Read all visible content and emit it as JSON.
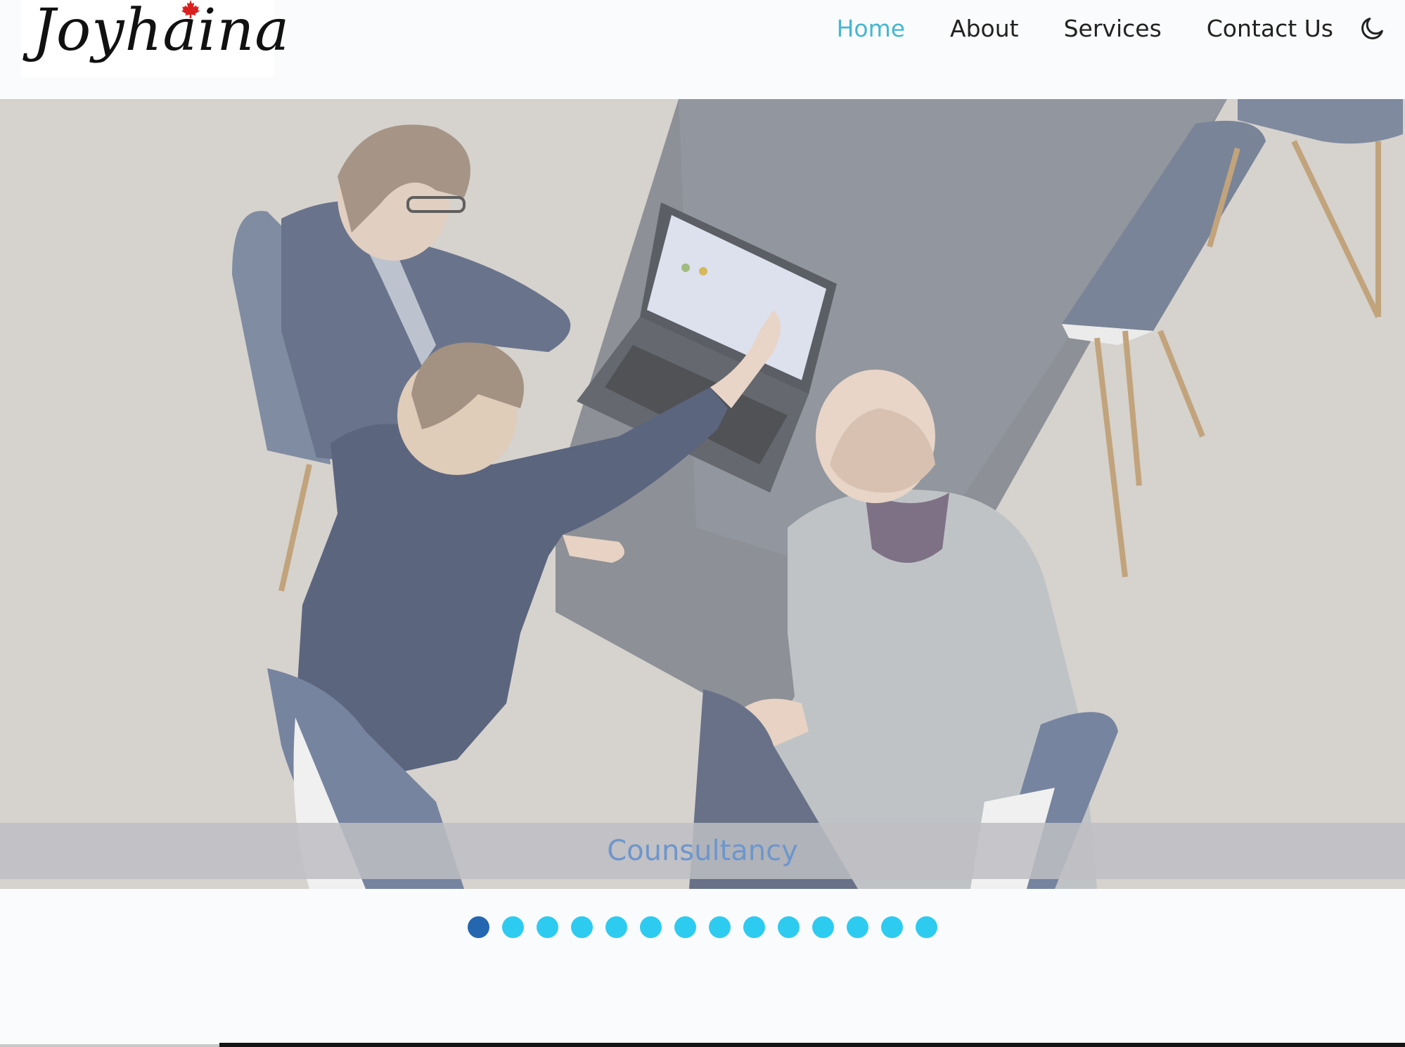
{
  "brand": {
    "name": "Joyhaina",
    "leaf_color": "#d9201f"
  },
  "nav": {
    "items": [
      {
        "label": "Home",
        "active": true
      },
      {
        "label": "About",
        "active": false
      },
      {
        "label": "Services",
        "active": false
      },
      {
        "label": "Contact Us",
        "active": false
      }
    ],
    "theme_toggle_icon": "moon-icon",
    "active_color": "#45b7d1"
  },
  "hero": {
    "caption": "Counsultancy",
    "image_subject": "three-people-meeting-laptop-photo"
  },
  "carousel": {
    "slide_count": 14,
    "active_index": 0,
    "dot_color": "#2ecbf0",
    "active_dot_color": "#2466b0"
  }
}
